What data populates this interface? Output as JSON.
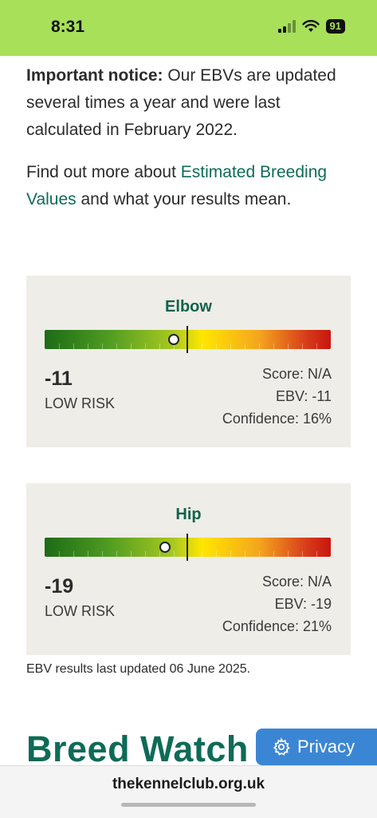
{
  "status": {
    "time": "8:31",
    "battery": "91"
  },
  "notice": {
    "label": "Important notice:",
    "text": "Our EBVs are updated several times a year and were last calculated in February 2022."
  },
  "more": {
    "prefix": "Find out more about",
    "link": "Estimated Breeding Values",
    "suffix": "and what your results mean."
  },
  "cards": [
    {
      "title": "Elbow",
      "value": "-11",
      "risk": "LOW RISK",
      "score": "Score: N/A",
      "ebv": "EBV: -11",
      "confidence": "Confidence: 16%",
      "marker_level": 0.45
    },
    {
      "title": "Hip",
      "value": "-19",
      "risk": "LOW RISK",
      "score": "Score: N/A",
      "ebv": "EBV: -19",
      "confidence": "Confidence: 21%",
      "marker_level": 0.42
    }
  ],
  "footnote": "EBV results last updated 06 June 2025.",
  "breed_watch": "Breed Watch",
  "privacy_button": "Privacy",
  "url": "thekennelclub.org.uk",
  "colors": {
    "status_bar": "#a8e05a",
    "link": "#0e6b57",
    "card_bg": "#eeede8",
    "privacy": "#3b86d4"
  },
  "icons": {
    "privacy": "gear-icon",
    "signal": "cellular-signal-icon",
    "wifi": "wifi-icon",
    "battery": "battery-icon"
  }
}
